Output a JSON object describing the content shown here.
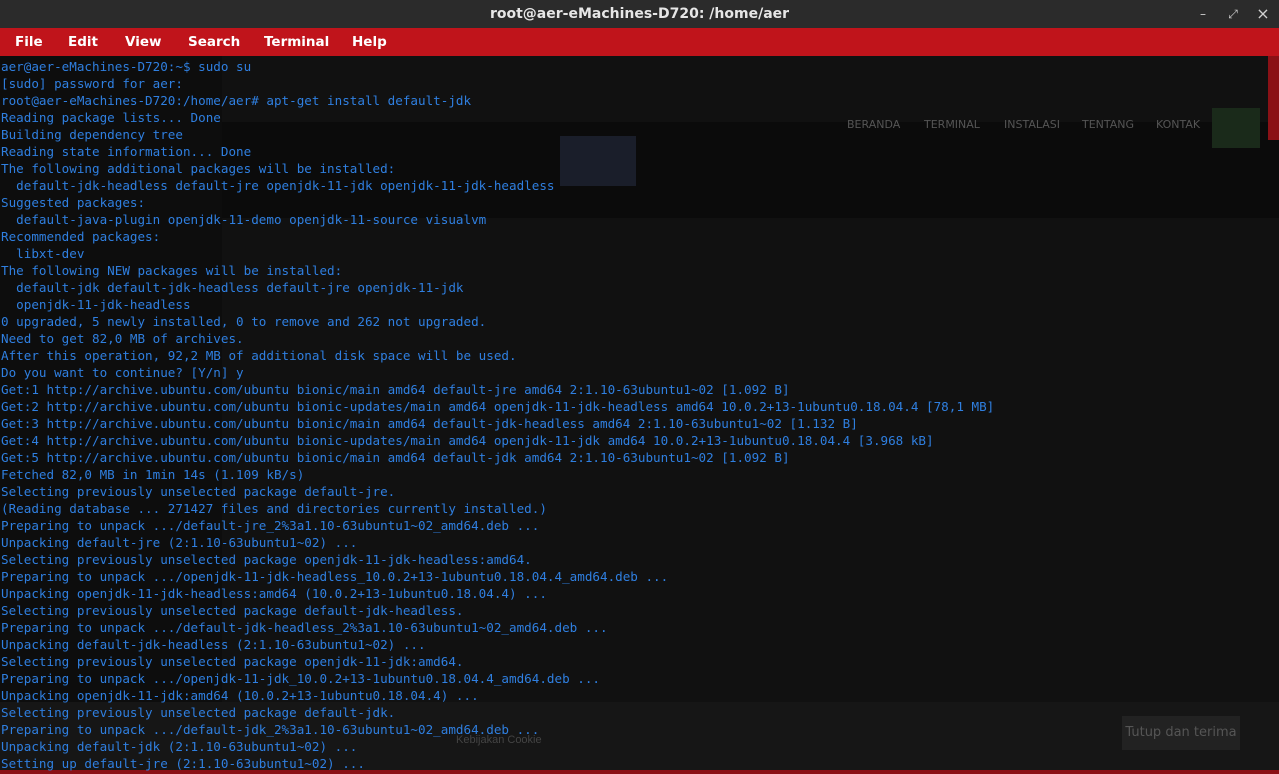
{
  "window": {
    "title": "root@aer-eMachines-D720: /home/aer",
    "minimize_glyph": "–",
    "restore_glyph": "⤢",
    "close_glyph": "×"
  },
  "menu": [
    "File",
    "Edit",
    "View",
    "Search",
    "Terminal",
    "Help"
  ],
  "colors": {
    "menubar": "#c0141b",
    "terminal_text": "#2f7fe0",
    "terminal_bg": "#111111"
  },
  "terminal": {
    "lines": [
      "aer@aer-eMachines-D720:~$ sudo su",
      "[sudo] password for aer: ",
      "root@aer-eMachines-D720:/home/aer# apt-get install default-jdk",
      "Reading package lists... Done",
      "Building dependency tree",
      "Reading state information... Done",
      "The following additional packages will be installed:",
      "  default-jdk-headless default-jre openjdk-11-jdk openjdk-11-jdk-headless",
      "Suggested packages:",
      "  default-java-plugin openjdk-11-demo openjdk-11-source visualvm",
      "Recommended packages:",
      "  libxt-dev",
      "The following NEW packages will be installed:",
      "  default-jdk default-jdk-headless default-jre openjdk-11-jdk",
      "  openjdk-11-jdk-headless",
      "0 upgraded, 5 newly installed, 0 to remove and 262 not upgraded.",
      "Need to get 82,0 MB of archives.",
      "After this operation, 92,2 MB of additional disk space will be used.",
      "Do you want to continue? [Y/n] y",
      "Get:1 http://archive.ubuntu.com/ubuntu bionic/main amd64 default-jre amd64 2:1.10-63ubuntu1~02 [1.092 B]",
      "Get:2 http://archive.ubuntu.com/ubuntu bionic-updates/main amd64 openjdk-11-jdk-headless amd64 10.0.2+13-1ubuntu0.18.04.4 [78,1 MB]",
      "Get:3 http://archive.ubuntu.com/ubuntu bionic/main amd64 default-jdk-headless amd64 2:1.10-63ubuntu1~02 [1.132 B]",
      "Get:4 http://archive.ubuntu.com/ubuntu bionic-updates/main amd64 openjdk-11-jdk amd64 10.0.2+13-1ubuntu0.18.04.4 [3.968 kB]",
      "Get:5 http://archive.ubuntu.com/ubuntu bionic/main amd64 default-jdk amd64 2:1.10-63ubuntu1~02 [1.092 B]",
      "Fetched 82,0 MB in 1min 14s (1.109 kB/s)",
      "Selecting previously unselected package default-jre.",
      "(Reading database ... 271427 files and directories currently installed.)",
      "Preparing to unpack .../default-jre_2%3a1.10-63ubuntu1~02_amd64.deb ...",
      "Unpacking default-jre (2:1.10-63ubuntu1~02) ...",
      "Selecting previously unselected package openjdk-11-jdk-headless:amd64.",
      "Preparing to unpack .../openjdk-11-jdk-headless_10.0.2+13-1ubuntu0.18.04.4_amd64.deb ...",
      "Unpacking openjdk-11-jdk-headless:amd64 (10.0.2+13-1ubuntu0.18.04.4) ...",
      "Selecting previously unselected package default-jdk-headless.",
      "Preparing to unpack .../default-jdk-headless_2%3a1.10-63ubuntu1~02_amd64.deb ...",
      "Unpacking default-jdk-headless (2:1.10-63ubuntu1~02) ...",
      "Selecting previously unselected package openjdk-11-jdk:amd64.",
      "Preparing to unpack .../openjdk-11-jdk_10.0.2+13-1ubuntu0.18.04.4_amd64.deb ...",
      "Unpacking openjdk-11-jdk:amd64 (10.0.2+13-1ubuntu0.18.04.4) ...",
      "Selecting previously unselected package default-jdk.",
      "Preparing to unpack .../default-jdk_2%3a1.10-63ubuntu1~02_amd64.deb ...",
      "Unpacking default-jdk (2:1.10-63ubuntu1~02) ...",
      "Setting up default-jre (2:1.10-63ubuntu1~02) ..."
    ]
  },
  "background_browser": {
    "nav": [
      "BERANDA",
      "TERMINAL",
      "INSTALASI",
      "TENTANG",
      "KONTAK"
    ],
    "cookie_button": "Tutup dan terima",
    "cookie_link": "Kebijakan Cookie"
  }
}
